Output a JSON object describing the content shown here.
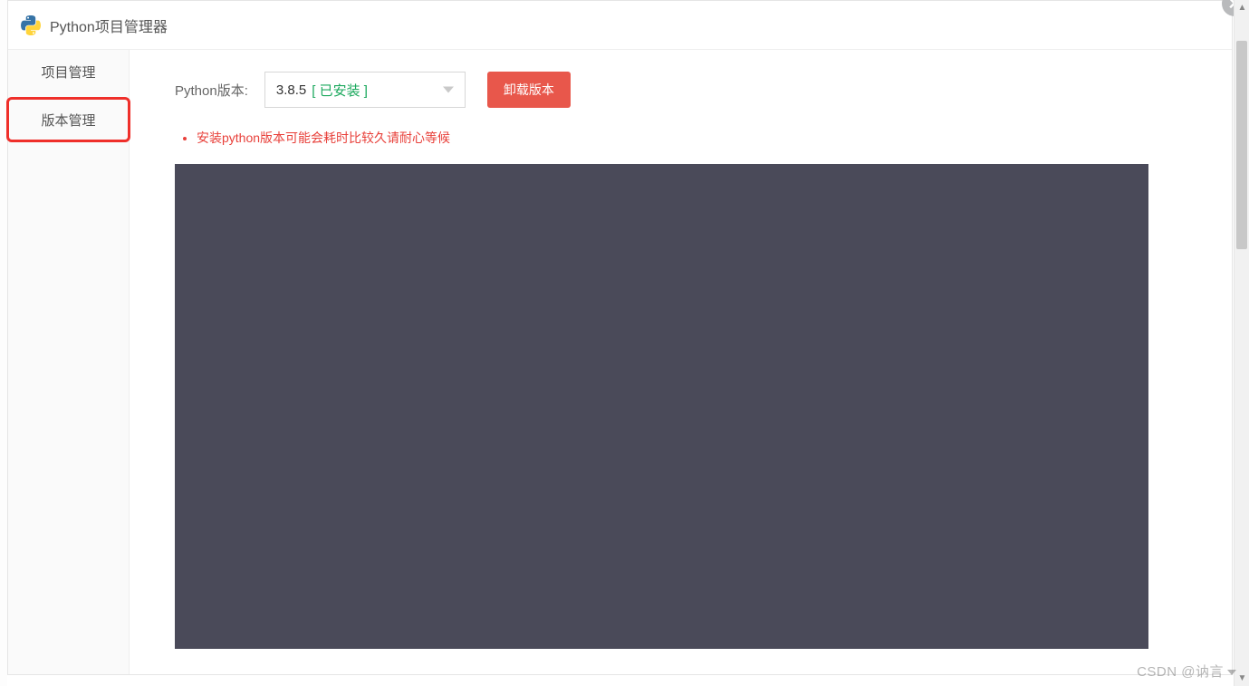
{
  "window": {
    "title": "Python项目管理器"
  },
  "sidebar": {
    "items": [
      {
        "label": "项目管理"
      },
      {
        "label": "版本管理"
      }
    ]
  },
  "main": {
    "version_label": "Python版本:",
    "selected_version": "3.8.5",
    "install_status": "[ 已安装 ]",
    "uninstall_button": "卸载版本",
    "warnings": [
      "安装python版本可能会耗时比较久请耐心等候"
    ]
  },
  "watermark": "CSDN @讷言"
}
